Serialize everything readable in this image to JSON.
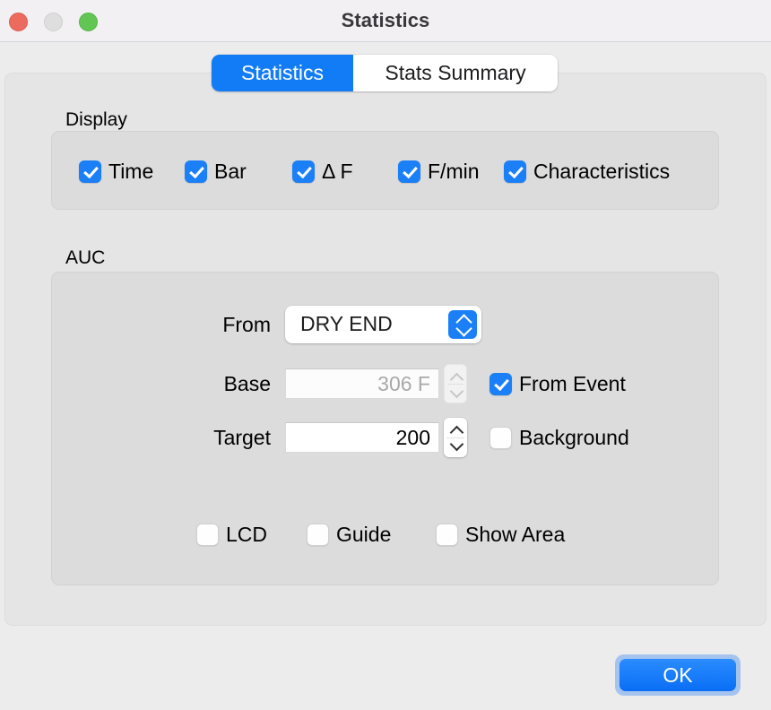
{
  "window": {
    "title": "Statistics",
    "controls": {
      "close": "close-button",
      "minimize": "minimize-button",
      "zoom": "zoom-button"
    }
  },
  "tabs": [
    {
      "label": "Statistics",
      "active": true
    },
    {
      "label": "Stats Summary",
      "active": false
    }
  ],
  "display": {
    "group_label": "Display",
    "checkboxes": [
      {
        "label": "Time",
        "checked": true
      },
      {
        "label": "Bar",
        "checked": true
      },
      {
        "label": "Δ F",
        "checked": true
      },
      {
        "label": "F/min",
        "checked": true
      },
      {
        "label": "Characteristics",
        "checked": true
      }
    ]
  },
  "auc": {
    "group_label": "AUC",
    "from": {
      "label": "From",
      "value": "DRY END",
      "options": [
        "DRY END"
      ]
    },
    "base": {
      "label": "Base",
      "value": "306 F",
      "enabled": false
    },
    "target": {
      "label": "Target",
      "value": "200",
      "enabled": true
    },
    "from_event": {
      "label": "From Event",
      "checked": true
    },
    "background": {
      "label": "Background",
      "checked": false
    },
    "options": [
      {
        "label": "LCD",
        "checked": false
      },
      {
        "label": "Guide",
        "checked": false
      },
      {
        "label": "Show Area",
        "checked": false
      }
    ]
  },
  "footer": {
    "ok_label": "OK"
  },
  "colors": {
    "accent": "#1b80f7",
    "window_background": "#ececec",
    "titlebar_background": "#f2f0f3",
    "panel_background": "#e5e5e5",
    "group_background": "#dcdcdc",
    "close": "#ec6a5e",
    "minimize": "#dedede",
    "zoom": "#62c554"
  }
}
